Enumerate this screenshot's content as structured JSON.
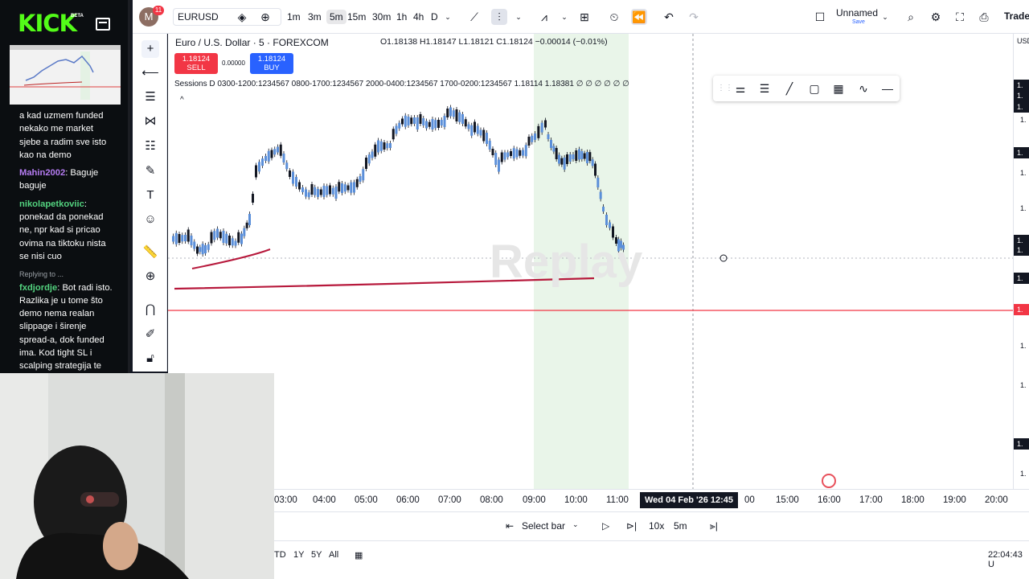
{
  "kick": {
    "logo": "KICK",
    "beta": "BETA"
  },
  "chat": {
    "messages": [
      {
        "user": "",
        "user_color": "#ffffff",
        "text": "a kad uzmem funded nekako me market sjebe a radim sve isto kao na demo"
      },
      {
        "user": "Mahin2002",
        "user_color": "#b57cf2",
        "text": ": Baguje baguje"
      },
      {
        "user": "nikolapetkoviic",
        "user_color": "#53d37f",
        "text": ": ponekad da ponekad ne, npr kad si pricao ovima na tiktoku nista se nisi cuo"
      },
      {
        "reply": "Replying to ...",
        "user": "fxdjordje",
        "user_color": "#53d37f",
        "text": ": Bot radi isto. Razlika je u tome što demo nema realan slippage i širenje spread-a, dok funded ima. Kod tight SL i scalping strategija te"
      }
    ]
  },
  "topbar": {
    "avatar": "M",
    "badge": "11",
    "symbol": "EURUSD",
    "timeframes": [
      "1m",
      "3m",
      "5m",
      "15m",
      "30m",
      "1h",
      "4h",
      "D"
    ],
    "active_tf": "5m",
    "layout_name": "Unnamed",
    "save": "Save",
    "trade": "Trade"
  },
  "legend": {
    "symbol": "Euro / U.S. Dollar · 5 · FOREXCOM",
    "ohlc": "O1.18138 H1.18147 L1.18121 C1.18124 −0.00014 (−0.01%)",
    "sell_price": "1.18124",
    "sell_label": "SELL",
    "spread": "0.00000",
    "buy_price": "1.18124",
    "buy_label": "BUY",
    "sessions": "Sessions D 0300-1200:1234567 0800-1700:1234567 2000-0400:1234567 1700-0200:1234567  1.18114  1.18381  ∅ ∅ ∅ ∅ ∅ ∅"
  },
  "watermark": "Replay",
  "price_scale": {
    "currency": "USD",
    "labels": [
      {
        "t": "1.",
        "kind": "dark"
      },
      {
        "t": "1.",
        "kind": "dark"
      },
      {
        "t": "1.",
        "kind": "dark"
      },
      {
        "t": "1.",
        "kind": "gray"
      },
      {
        "t": "1.",
        "kind": "dark"
      },
      {
        "t": "1.",
        "kind": "gray"
      },
      {
        "t": "1.",
        "kind": "gray"
      },
      {
        "t": "1.",
        "kind": "dark"
      },
      {
        "t": "1.",
        "kind": "dark"
      },
      {
        "t": "1.",
        "kind": "dark"
      },
      {
        "t": "1.",
        "kind": "red"
      },
      {
        "t": "1.",
        "kind": "gray"
      },
      {
        "t": "1.",
        "kind": "gray"
      },
      {
        "t": "1.",
        "kind": "dark"
      },
      {
        "t": "1.",
        "kind": "gray"
      }
    ]
  },
  "time_axis": {
    "ticks": [
      "03:00",
      "04:00",
      "05:00",
      "06:00",
      "07:00",
      "08:00",
      "09:00",
      "10:00",
      "11:00",
      "00",
      "15:00",
      "16:00",
      "17:00",
      "18:00",
      "19:00",
      "20:00"
    ],
    "crosshair": "Wed 04 Feb '26   12:45"
  },
  "replay_bar": {
    "select_bar": "Select bar",
    "speed": "10x",
    "interval": "5m"
  },
  "footer": {
    "ranges": [
      "TD",
      "1Y",
      "5Y",
      "All"
    ],
    "clock": "22:04:43 U"
  }
}
